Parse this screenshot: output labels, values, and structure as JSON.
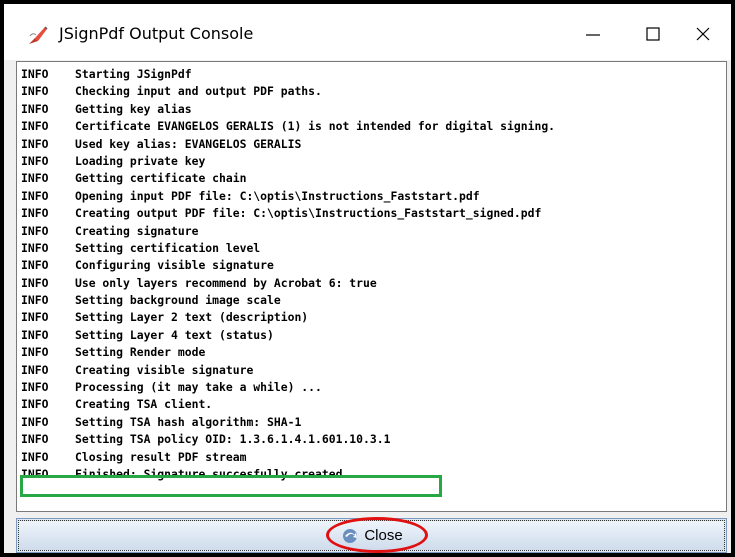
{
  "window": {
    "title": "JSignPdf Output Console",
    "icon": "pen-signature-icon",
    "controls": [
      "minimize-icon",
      "maximize-icon",
      "close-icon"
    ]
  },
  "console": {
    "lines": [
      {
        "level": "INFO",
        "message": "Starting JSignPdf"
      },
      {
        "level": "INFO",
        "message": "Checking input and output PDF paths."
      },
      {
        "level": "INFO",
        "message": "Getting key alias"
      },
      {
        "level": "INFO",
        "message": "Certificate EVANGELOS GERALIS (1) is not intended for digital signing."
      },
      {
        "level": "INFO",
        "message": "Used key alias: EVANGELOS GERALIS"
      },
      {
        "level": "INFO",
        "message": "Loading private key"
      },
      {
        "level": "INFO",
        "message": "Getting certificate chain"
      },
      {
        "level": "INFO",
        "message": "Opening input PDF file: C:\\optis\\Instructions_Faststart.pdf"
      },
      {
        "level": "INFO",
        "message": "Creating output PDF file: C:\\optis\\Instructions_Faststart_signed.pdf"
      },
      {
        "level": "INFO",
        "message": "Creating signature"
      },
      {
        "level": "INFO",
        "message": "Setting certification level"
      },
      {
        "level": "INFO",
        "message": "Configuring visible signature"
      },
      {
        "level": "INFO",
        "message": "Use only layers recommend by Acrobat 6: true"
      },
      {
        "level": "INFO",
        "message": "Setting background image scale"
      },
      {
        "level": "INFO",
        "message": "Setting Layer 2 text (description)"
      },
      {
        "level": "INFO",
        "message": "Setting Layer 4 text (status)"
      },
      {
        "level": "INFO",
        "message": "Setting Render mode"
      },
      {
        "level": "INFO",
        "message": "Creating visible signature"
      },
      {
        "level": "INFO",
        "message": "Processing (it may take a while) ..."
      },
      {
        "level": "INFO",
        "message": "Creating TSA client."
      },
      {
        "level": "INFO",
        "message": "Setting TSA hash algorithm: SHA-1"
      },
      {
        "level": "INFO",
        "message": "Setting TSA policy OID: 1.3.6.1.4.1.601.10.3.1"
      },
      {
        "level": "INFO",
        "message": "Closing result PDF stream"
      },
      {
        "level": "INFO",
        "message": "Finished: Signature succesfully created."
      }
    ],
    "highlighted_line_color": "#27a844"
  },
  "footer": {
    "close_label": "Close",
    "close_icon": "close-arrow-icon",
    "annotation_color": "#e01010"
  }
}
